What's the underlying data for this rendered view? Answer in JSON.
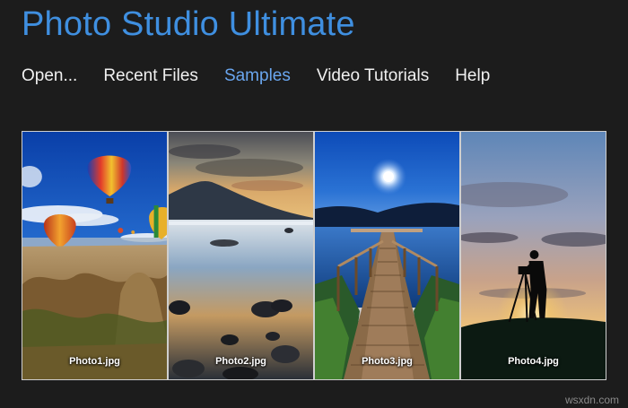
{
  "app": {
    "title": "Photo Studio Ultimate",
    "accent_color": "#3f8fe0"
  },
  "nav": {
    "items": [
      {
        "label": "Open..."
      },
      {
        "label": "Recent Files"
      },
      {
        "label": "Samples",
        "active": true
      },
      {
        "label": "Video Tutorials"
      },
      {
        "label": "Help"
      }
    ]
  },
  "samples": [
    {
      "label": "Photo1.jpg",
      "subject": "hot air balloons over rocky valley"
    },
    {
      "label": "Photo2.jpg",
      "subject": "lake reflection with rocks at sunset"
    },
    {
      "label": "Photo3.jpg",
      "subject": "wooden pier under moonlit blue sky"
    },
    {
      "label": "Photo4.jpg",
      "subject": "photographer silhouette with tripod at sunset"
    }
  ],
  "watermark": "wsxdn.com"
}
